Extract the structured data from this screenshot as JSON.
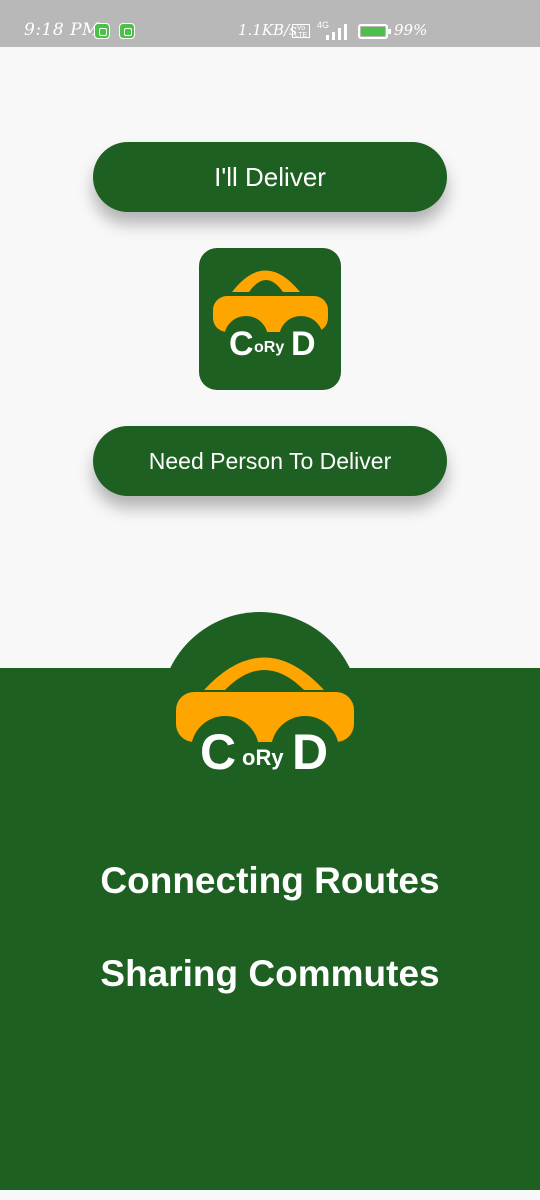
{
  "status_bar": {
    "time": "9:18 PM",
    "speed": "1.1KB/s",
    "volte": "VoLTE",
    "network": "4G",
    "battery_level": 0.99,
    "battery": "99%"
  },
  "actions": {
    "deliver_label": "I'll Deliver",
    "request_label": "Need Person To Deliver"
  },
  "logo": {
    "letters_big_left": "C",
    "letters_small": "oRy",
    "letters_big_right": "D"
  },
  "taglines": {
    "line1": "Connecting Routes",
    "line2": "Sharing Commutes"
  },
  "colors": {
    "brand_green": "#1e5f22",
    "car_yellow": "#ffa500",
    "background": "#f8f8f9"
  }
}
